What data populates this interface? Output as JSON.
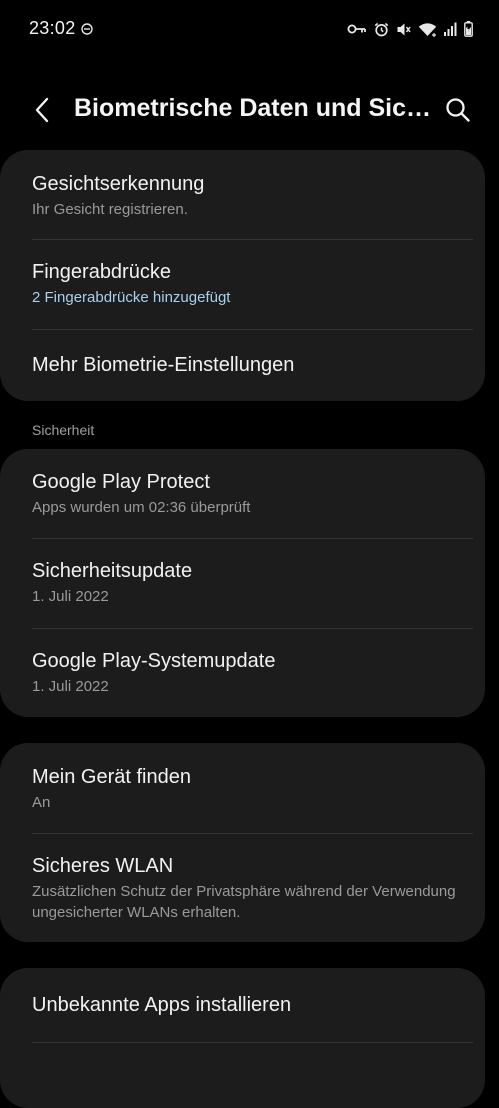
{
  "status_bar": {
    "time": "23:02",
    "icons": [
      "do-not-disturb-icon",
      "vpn-key-icon",
      "alarm-icon",
      "mute-icon",
      "wifi-icon",
      "signal-icon",
      "battery-icon"
    ]
  },
  "header": {
    "title": "Biometrische Daten und Sicherheit",
    "back_icon": "back-arrow-icon",
    "search_icon": "search-icon"
  },
  "biometrics_card": {
    "items": [
      {
        "title": "Gesichtserkennung",
        "subtitle": "Ihr Gesicht registrieren."
      },
      {
        "title": "Fingerabdrücke",
        "subtitle": "2 Fingerabdrücke hinzugefügt"
      },
      {
        "title": "Mehr Biometrie-Einstellungen"
      }
    ]
  },
  "security_section": {
    "label": "Sicherheit",
    "items": [
      {
        "title": "Google Play Protect",
        "subtitle": "Apps wurden um 02:36 überprüft"
      },
      {
        "title": "Sicherheitsupdate",
        "subtitle": "1. Juli 2022"
      },
      {
        "title": "Google Play-Systemupdate",
        "subtitle": "1. Juli 2022"
      }
    ]
  },
  "device_card": {
    "items": [
      {
        "title": "Mein Gerät finden",
        "subtitle": "An"
      },
      {
        "title": "Sicheres WLAN",
        "subtitle": "Zusätzlichen Schutz der Privatsphäre während der Verwendung ungesicherter WLANs erhalten."
      }
    ]
  },
  "apps_card": {
    "items": [
      {
        "title": "Unbekannte Apps installieren"
      }
    ]
  },
  "colors": {
    "background": "#000000",
    "card": "#1c1c1c",
    "accent_subtitle": "#a7d1ee",
    "secondary_text": "#9a9a9a"
  }
}
